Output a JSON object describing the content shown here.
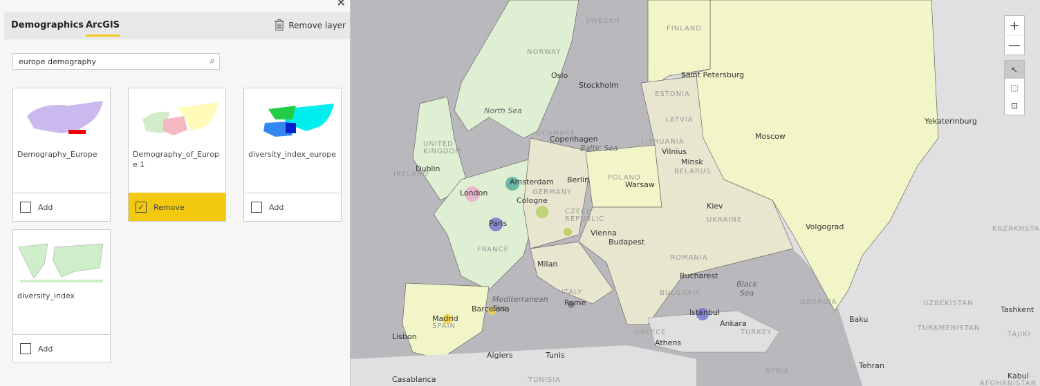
{
  "panel": {
    "tabs": [
      "Demographics",
      "ArcGIS"
    ],
    "active_tab": "ArcGIS",
    "remove_layer": "Remove layer",
    "search_value": "europe demography",
    "cards": [
      {
        "title": "Demography_Europe",
        "action": "Add",
        "checked": false
      },
      {
        "title": "Demography_of_Europe 1",
        "action": "Remove",
        "checked": true
      },
      {
        "title": "diversity_index_europe",
        "action": "Add",
        "checked": false
      },
      {
        "title": "diversity_index",
        "action": "Add",
        "checked": false
      }
    ]
  },
  "map": {
    "controls": {
      "zoom_in": "+",
      "zoom_out": "—"
    },
    "labels": {
      "sweden": "SWEDEN",
      "finland": "FINLAND",
      "norway": "NORWAY",
      "oslo": "Oslo",
      "stockholm": "Stockholm",
      "stpete": "Saint Petersburg",
      "estonia": "ESTONIA",
      "latvia": "LATVIA",
      "lithuania": "LITHUANIA",
      "vilnius": "Vilnius",
      "minsk": "Minsk",
      "belarus": "BELARUS",
      "moscow": "Moscow",
      "yekat": "Yekaterinburg",
      "northsea": "North Sea",
      "denmark": "DENMARK",
      "copenhagen": "Copenhagen",
      "baltic": "Baltic Sea",
      "uk": "UNITED KINGDOM",
      "ireland": "IRELAND",
      "dublin": "Dublin",
      "london": "London",
      "amsterdam": "Amsterdam",
      "berlin": "Berlin",
      "germany": "GERMANY",
      "poland": "POLAND",
      "warsaw": "Warsaw",
      "cologne": "Cologne",
      "czech": "CZECH REPUBLIC",
      "paris": "Paris",
      "france": "FRANCE",
      "vienna": "Vienna",
      "budapest": "Budapest",
      "kiev": "Kiev",
      "ukraine": "UKRAINE",
      "volgograd": "Volgograd",
      "kazakhstan": "KAZAKHSTAN",
      "romania": "ROMANIA",
      "milan": "Milan",
      "bucharest": "Bucharest",
      "bulgaria": "BULGARIA",
      "blacksea": "Black Sea",
      "medsea": "Mediterranean Sea",
      "italy": "ITALY",
      "rome": "Rome",
      "barcelona": "Barcelona",
      "madrid": "Madrid",
      "spain": "SPAIN",
      "lisbon": "Lisbon",
      "istanbul": "Istanbul",
      "ankara": "Ankara",
      "turkey": "TURKEY",
      "georgia": "GEORGIA",
      "uzbekistan": "UZBEKISTAN",
      "tashkent": "Tashkent",
      "baku": "Baku",
      "turkmenistan": "TURKMENISTAN",
      "tajik": "TAJIKI",
      "tehran": "Tehran",
      "syria": "SYRIA",
      "algiers": "Algiers",
      "tunis": "Tunis",
      "tunisia": "TUNISIA",
      "greece": "GREECE",
      "athens": "Athens",
      "casablanca": "Casablanca",
      "kabul": "Kabul",
      "afghanistan": "AFGHANISTAN"
    },
    "colors": {
      "accent": "#f2c811",
      "water": "#b9b9bd",
      "land": "#e0e0e0",
      "russia": "#f1f5c8",
      "west": "#deefd3",
      "central": "#e8e6cf"
    }
  }
}
